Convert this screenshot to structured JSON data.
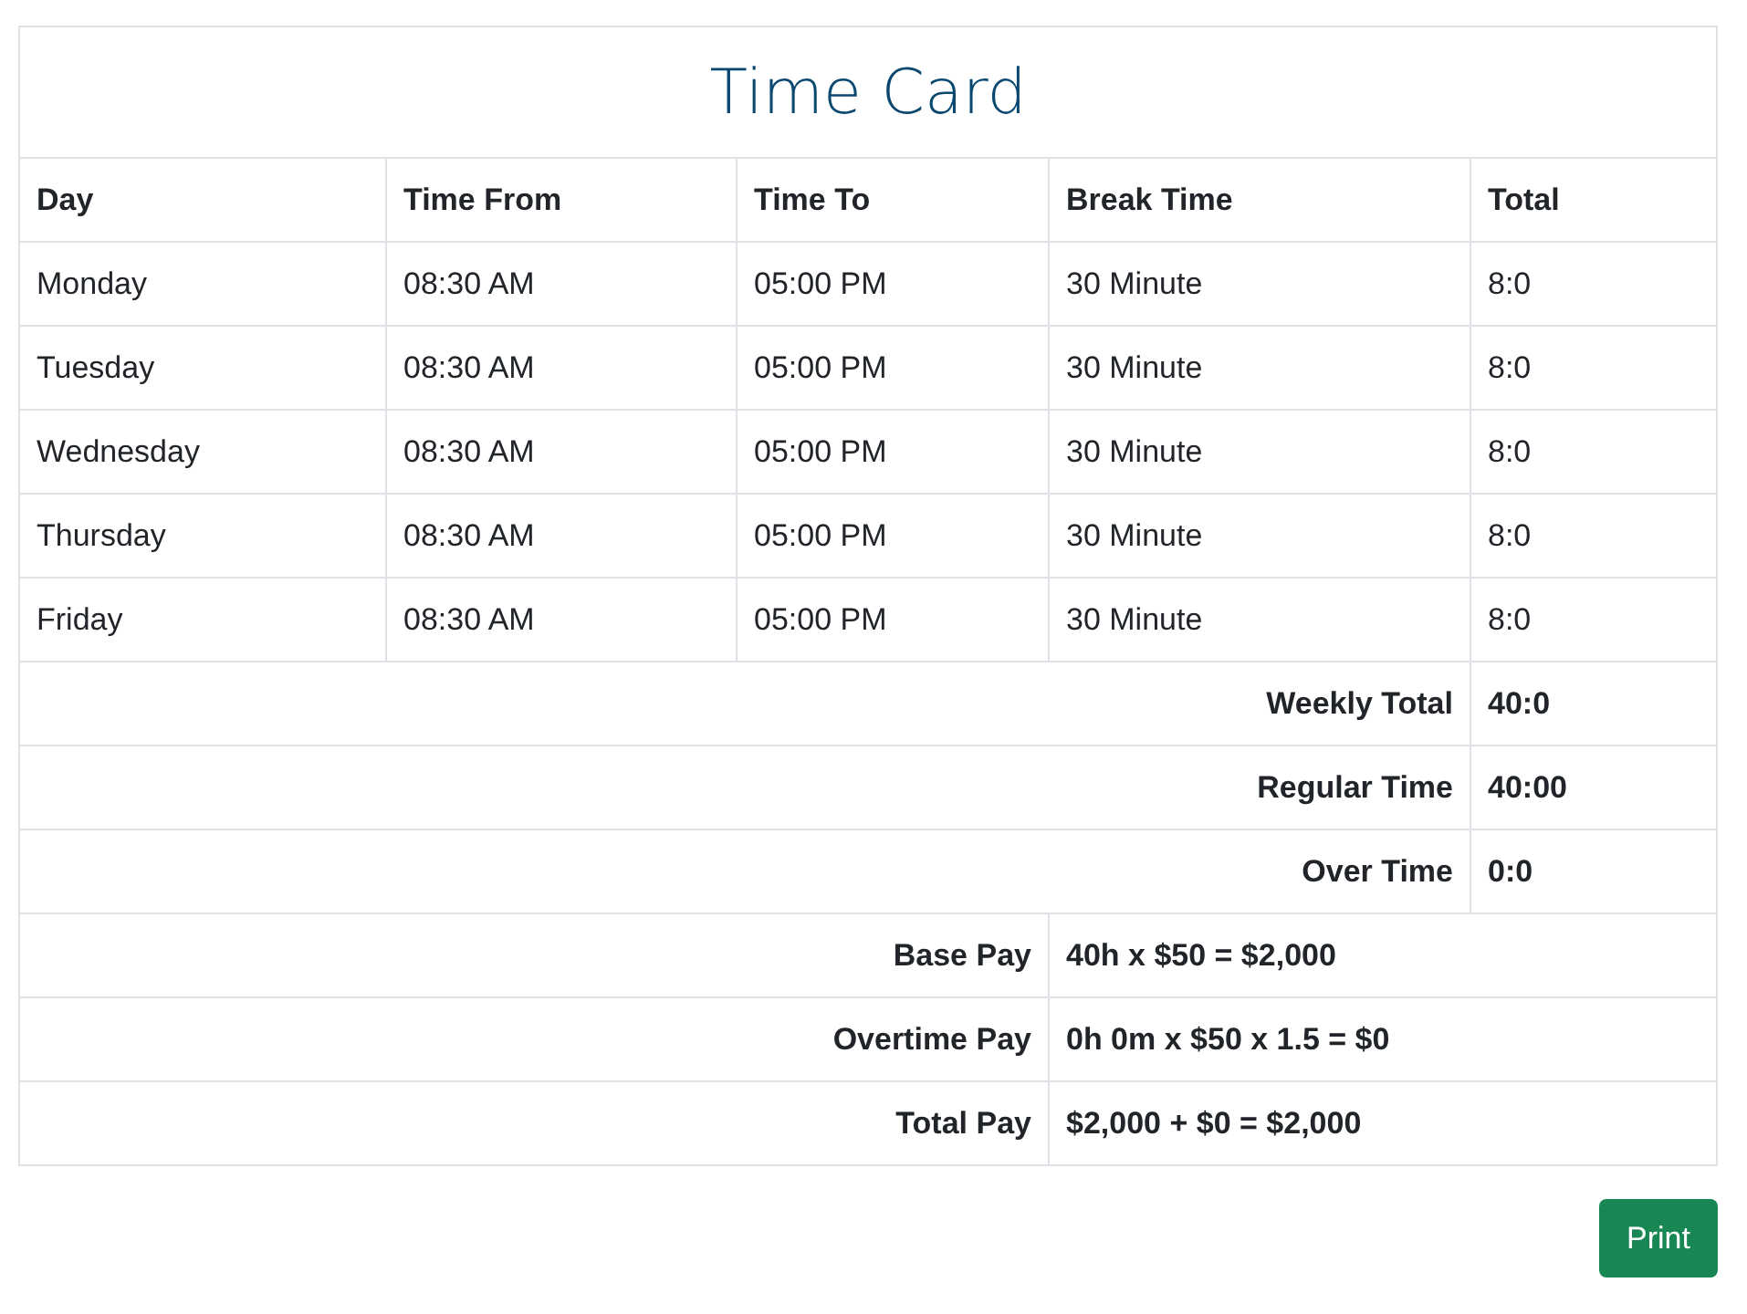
{
  "title": "Time Card",
  "columns": [
    "Day",
    "Time From",
    "Time To",
    "Break Time",
    "Total"
  ],
  "rows": [
    [
      "Monday",
      "08:30 AM",
      "05:00 PM",
      "30 Minute",
      "8:0"
    ],
    [
      "Tuesday",
      "08:30 AM",
      "05:00 PM",
      "30 Minute",
      "8:0"
    ],
    [
      "Wednesday",
      "08:30 AM",
      "05:00 PM",
      "30 Minute",
      "8:0"
    ],
    [
      "Thursday",
      "08:30 AM",
      "05:00 PM",
      "30 Minute",
      "8:0"
    ],
    [
      "Friday",
      "08:30 AM",
      "05:00 PM",
      "30 Minute",
      "8:0"
    ]
  ],
  "totals": [
    {
      "label": "Weekly Total",
      "value": "40:0"
    },
    {
      "label": "Regular Time",
      "value": "40:00"
    },
    {
      "label": "Over Time",
      "value": "0:0"
    }
  ],
  "pay": [
    {
      "label": "Base Pay",
      "value": "40h x $50 = $2,000"
    },
    {
      "label": "Overtime Pay",
      "value": "0h 0m x $50 x 1.5 = $0"
    },
    {
      "label": "Total Pay",
      "value": "$2,000 + $0 = $2,000"
    }
  ],
  "print_button": "Print"
}
